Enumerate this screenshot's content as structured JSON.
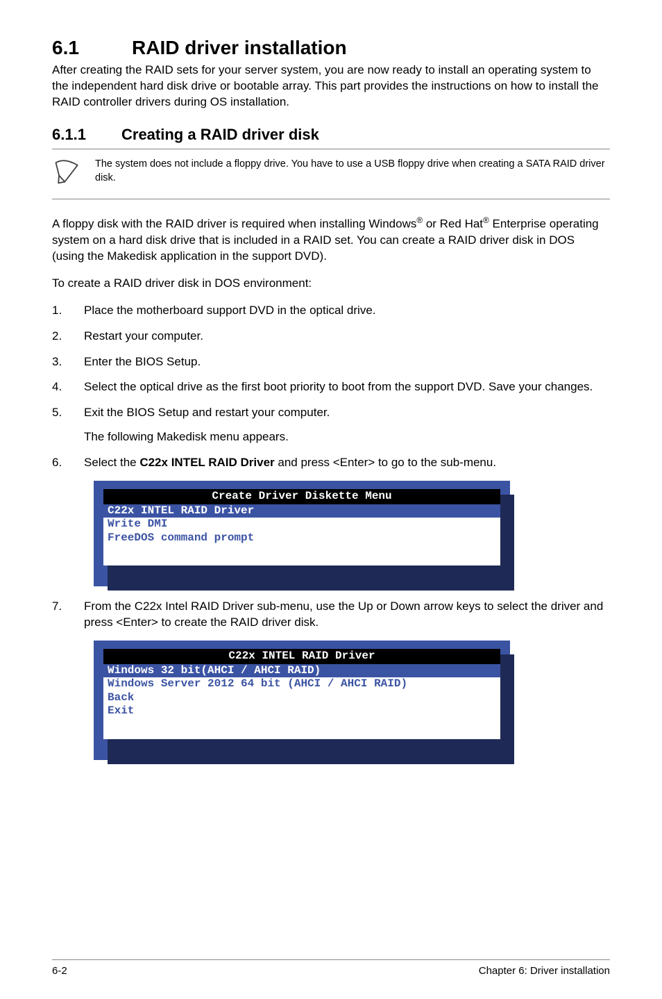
{
  "section": {
    "number": "6.1",
    "title": "RAID driver installation",
    "intro": "After creating the RAID sets for your server system, you are now ready to install an operating system to the independent hard disk drive or bootable array. This part provides the instructions on how to install the RAID controller drivers during OS installation."
  },
  "subsection": {
    "number": "6.1.1",
    "title": "Creating a RAID driver disk"
  },
  "note": "The system does not include a floppy drive. You have to use a USB floppy drive when creating a SATA RAID driver disk.",
  "para1_pre": "A floppy disk with the RAID driver is required when installing Windows",
  "para1_mid": " or Red Hat",
  "para1_post": " Enterprise operating system on a hard disk drive that is included in a RAID set. You can create a RAID driver disk in DOS (using the Makedisk application in the support DVD).",
  "reg": "®",
  "para2": "To create a RAID driver disk in DOS environment:",
  "steps": {
    "1": {
      "n": "1.",
      "body": "Place the motherboard support DVD in the optical drive."
    },
    "2": {
      "n": "2.",
      "body": "Restart your computer."
    },
    "3": {
      "n": "3.",
      "body": "Enter the BIOS Setup."
    },
    "4": {
      "n": "4.",
      "body": "Select the optical drive as the first boot priority to boot from the support DVD. Save your changes."
    },
    "5": {
      "n": "5.",
      "body": "Exit the BIOS Setup and restart your computer.",
      "body2": "The following Makedisk menu appears."
    },
    "6": {
      "n": "6.",
      "pre": "Select the ",
      "strong": "C22x INTEL RAID Driver",
      "post": " and press <Enter> to go to the sub-menu."
    },
    "7": {
      "n": "7.",
      "body": "From the C22x Intel RAID Driver sub-menu, use the Up or Down arrow keys to select the driver and press <Enter> to create the RAID driver disk."
    }
  },
  "menu1": {
    "title": " Create Driver Diskette Menu ",
    "sel": "C22x INTEL RAID Driver",
    "i1": "Write DMI",
    "i2": "FreeDOS command prompt"
  },
  "menu2": {
    "title": "C22x INTEL RAID Driver",
    "sel": "Windows 32 bit(AHCI / AHCI RAID)",
    "i1": "Windows Server 2012 64 bit (AHCI / AHCI RAID)",
    "i2": "Back",
    "i3": "Exit"
  },
  "footer": {
    "left": "6-2",
    "right": "Chapter 6: Driver installation"
  }
}
